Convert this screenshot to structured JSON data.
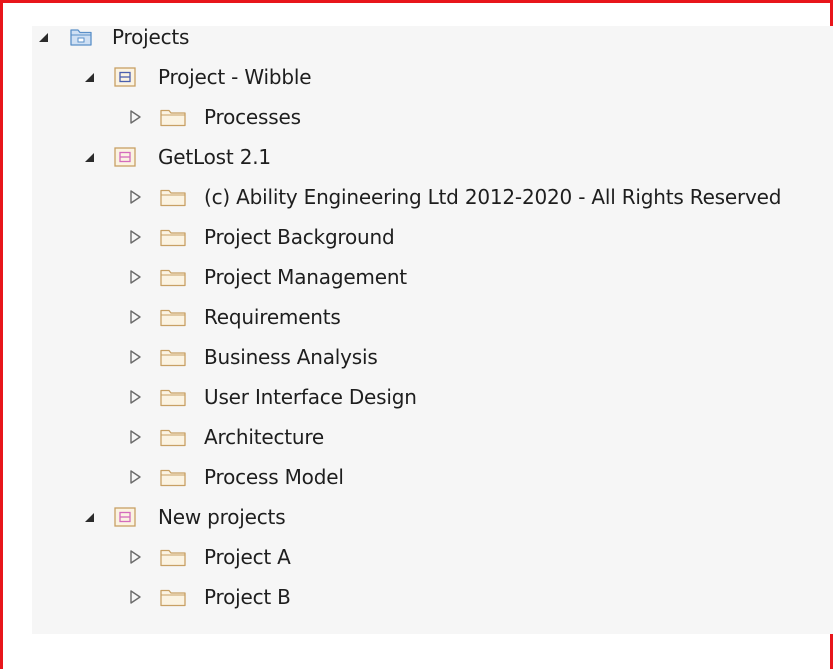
{
  "tree": {
    "root": {
      "label": "Projects",
      "icon": "model-root-icon",
      "expanded": true
    },
    "project_wibble": {
      "label": "Project - Wibble",
      "icon": "package-icon",
      "expanded": true,
      "children": [
        "Processes"
      ]
    },
    "getlost": {
      "label": "GetLost 2.1",
      "icon": "package-icon",
      "expanded": true,
      "children": [
        "(c) Ability Engineering Ltd 2012-2020 - All Rights Reserved",
        "Project Background",
        "Project Management",
        "Requirements",
        "Business Analysis",
        "User Interface Design",
        "Architecture",
        "Process Model"
      ]
    },
    "new_projects": {
      "label": "New projects",
      "icon": "package-icon",
      "expanded": true,
      "children": [
        "Project A",
        "Project B"
      ]
    }
  },
  "colors": {
    "frame_border": "#e8161b",
    "panel_bg": "#f6f6f6",
    "folder_stroke": "#c8a064",
    "folder_fill": "#fbf3e2",
    "package_blue": "#4a5fae",
    "package_pink": "#d36bbd",
    "root_blue": "#5a8fc8"
  }
}
